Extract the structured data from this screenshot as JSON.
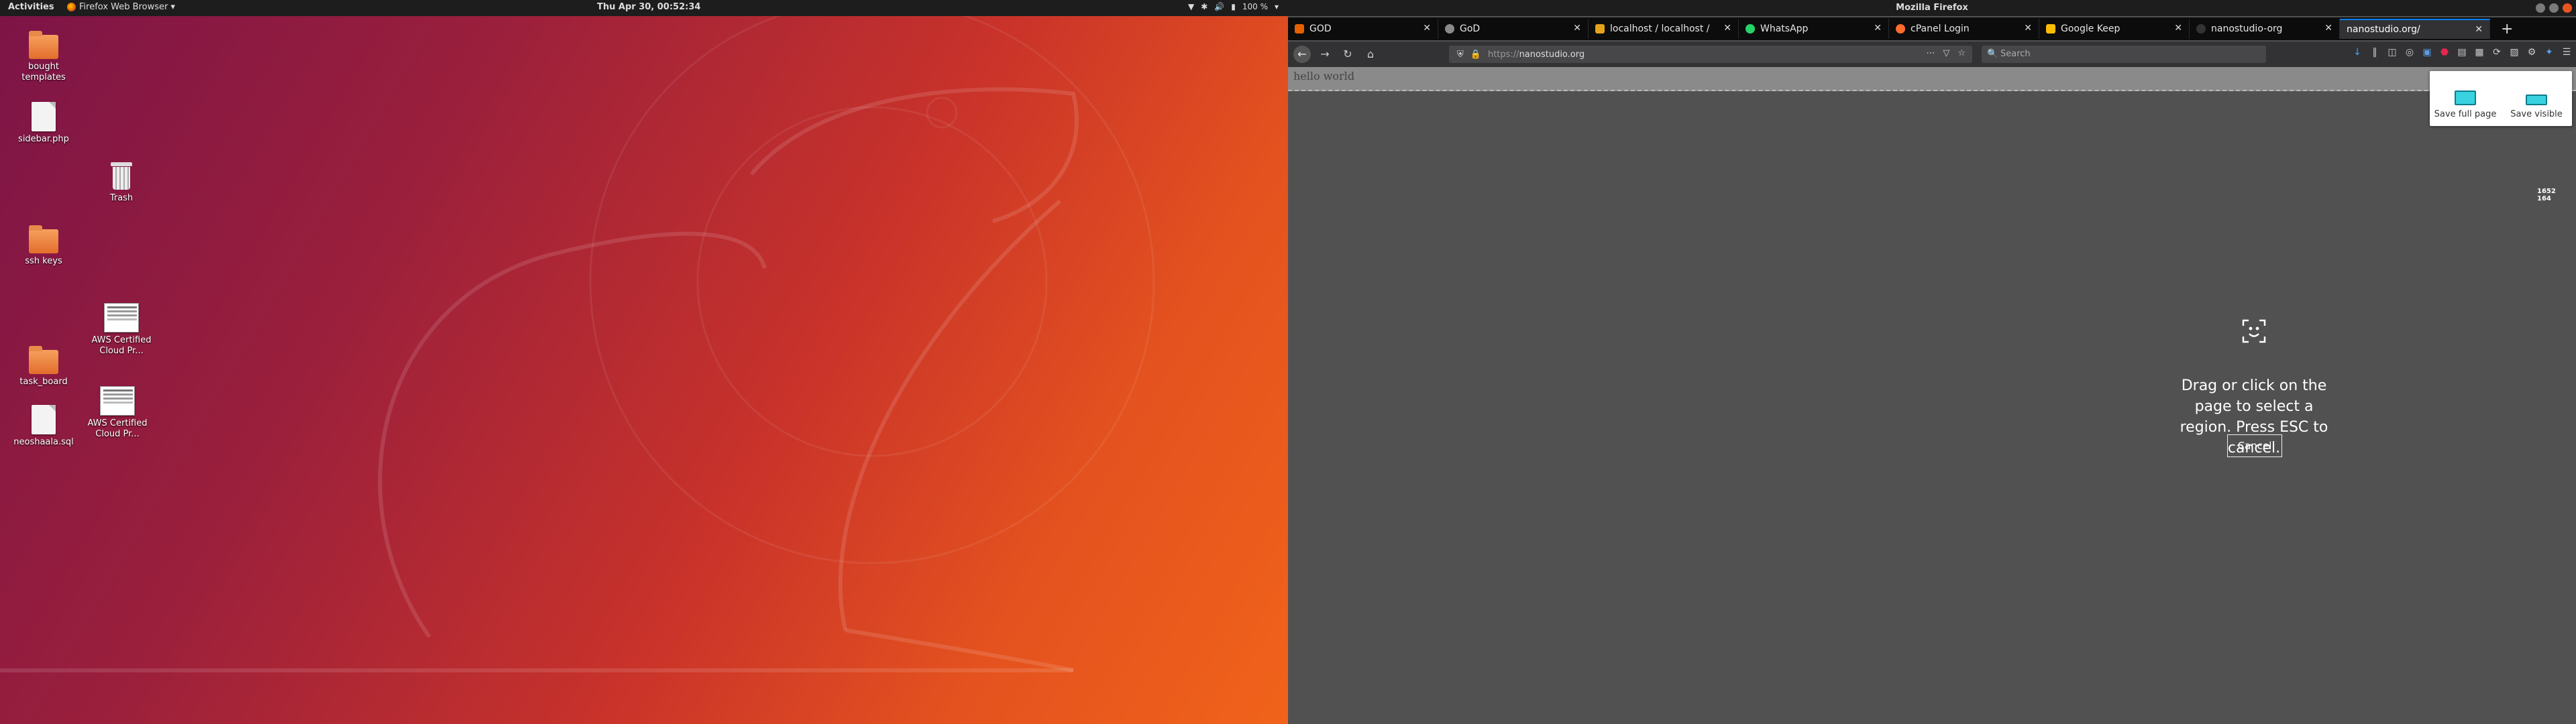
{
  "topbar": {
    "activities": "Activities",
    "app_menu": "Firefox Web Browser ▾",
    "clock": "Thu Apr 30, 00:52:34",
    "battery": "100 %"
  },
  "desktop_icons": [
    {
      "label": "bought templates",
      "kind": "folder"
    },
    {
      "label": "sidebar.php",
      "kind": "file"
    },
    {
      "label": "Trash",
      "kind": "trash"
    },
    {
      "label": "ssh keys",
      "kind": "folder"
    },
    {
      "label": "AWS Certified Cloud Pr...",
      "kind": "thumb"
    },
    {
      "label": "task_board",
      "kind": "folder"
    },
    {
      "label": "AWS Certified Cloud Pr...",
      "kind": "thumb"
    },
    {
      "label": "neoshaala.sql",
      "kind": "file"
    }
  ],
  "firefox": {
    "window_title": "Mozilla Firefox",
    "tabs": [
      {
        "label": "GOD",
        "favicon_color": "#e66000"
      },
      {
        "label": "GoD",
        "favicon_color": "#8a8a8a"
      },
      {
        "label": "localhost / localhost / g...",
        "favicon_color": "#e4a11b"
      },
      {
        "label": "WhatsApp",
        "favicon_color": "#25d366"
      },
      {
        "label": "cPanel Login",
        "favicon_color": "#ff6c2c"
      },
      {
        "label": "Google Keep",
        "favicon_color": "#fbbc04"
      },
      {
        "label": "nanostudio-org",
        "favicon_color": "#333333"
      },
      {
        "label": "nanostudio.org/",
        "favicon_color": "#323234"
      }
    ],
    "new_tab": "+",
    "url": {
      "scheme": "https://",
      "host": "nanostudio.org"
    },
    "search_placeholder": "Search",
    "page_text": "hello world",
    "screenshot_panel": {
      "save_full": "Save full page",
      "save_visible": "Save visible"
    },
    "coords": {
      "line1": "1652",
      "line2": "164"
    },
    "instruction": "Drag or click on the page to select a region. Press ESC to cancel.",
    "cancel": "Cancel"
  },
  "colors": {
    "accent": "#0a84ff",
    "ubuntu_orange": "#e95420"
  }
}
